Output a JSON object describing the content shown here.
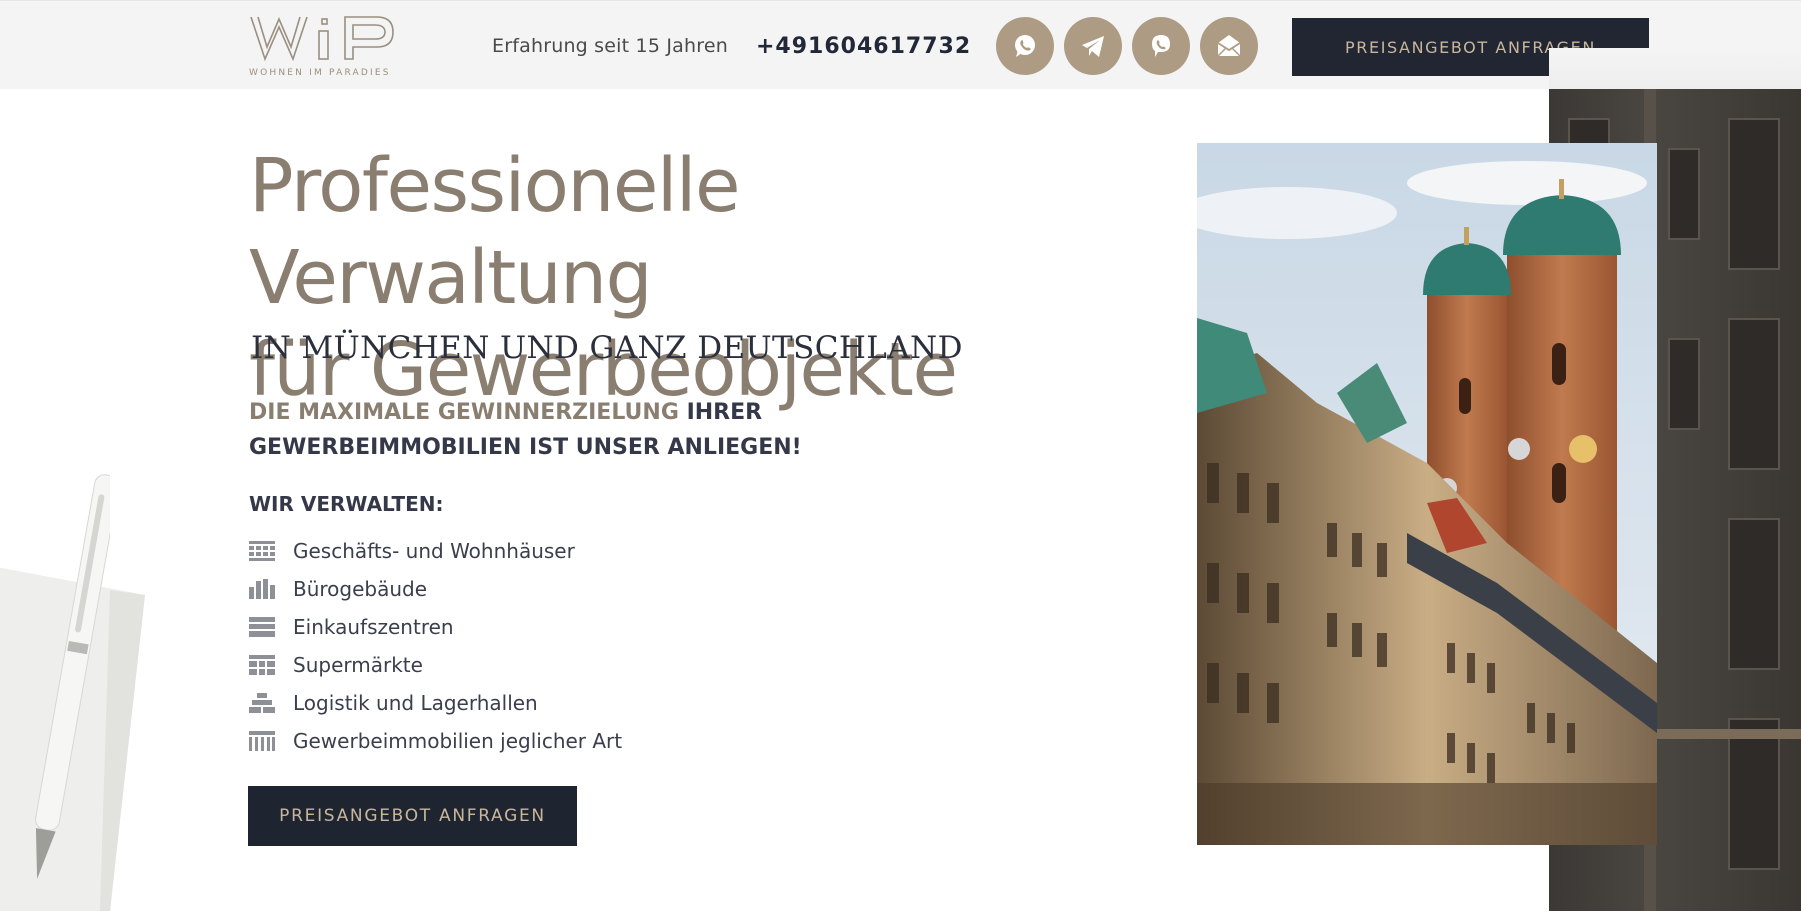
{
  "header": {
    "logo_text": "WiP",
    "logo_tagline": "WOHNEN IM PARADIES",
    "experience": "Erfahrung seit 15 Jahren",
    "phone": "+491604617732",
    "social": [
      {
        "icon": "whatsapp-icon"
      },
      {
        "icon": "telegram-icon"
      },
      {
        "icon": "viber-icon"
      },
      {
        "icon": "email-icon"
      }
    ],
    "cta_label": "PREISANGEBOT ANFRAGEN"
  },
  "hero": {
    "title_line1": "Professionelle Verwaltung",
    "title_line2": "für Gewerbeobjekte",
    "subtitle": "IN MÜNCHEN UND GANZ DEUTSCHLAND",
    "tagline_accent": "DIE MAXIMALE GEWINNERZIELUNG",
    "tagline_rest": "IHRER GEWERBEIMMOBILIEN IST UNSER ANLIEGEN!",
    "manage_title": "WIR VERWALTEN:",
    "services": [
      {
        "label": "Geschäfts- und Wohnhäuser",
        "icon": "building-grid-icon"
      },
      {
        "label": "Bürogebäude",
        "icon": "office-bars-icon"
      },
      {
        "label": "Einkaufszentren",
        "icon": "mall-lines-icon"
      },
      {
        "label": "Supermärkte",
        "icon": "supermarket-icon"
      },
      {
        "label": "Logistik und Lagerhallen",
        "icon": "warehouse-icon"
      },
      {
        "label": "Gewerbeimmobilien jeglicher Art",
        "icon": "columns-icon"
      }
    ],
    "cta_label": "PREISANGEBOT ANFRAGEN"
  },
  "colors": {
    "accent": "#8a7e70",
    "gold": "#ad9c83",
    "dark": "#222632",
    "button_text": "#c8b79c"
  }
}
